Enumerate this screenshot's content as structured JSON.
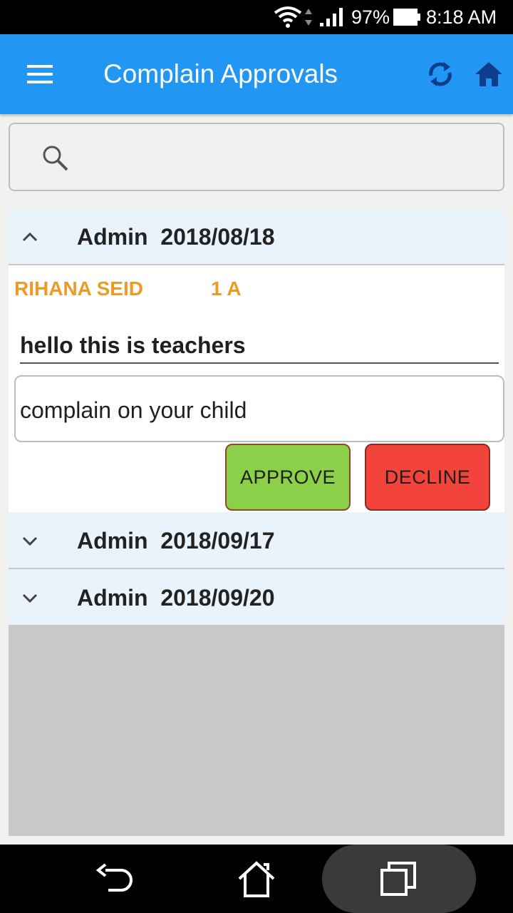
{
  "status_bar": {
    "battery_percent": "97%",
    "time": "8:18 AM",
    "icons": [
      "wifi-icon",
      "data-updown-icon",
      "signal-icon",
      "battery-icon"
    ]
  },
  "app_bar": {
    "title": "Complain Approvals",
    "icons": [
      "menu-icon",
      "sync-icon",
      "home-icon"
    ],
    "color": "#2196f3"
  },
  "search": {
    "value": "",
    "icon": "search-icon"
  },
  "groups": [
    {
      "title": "Admin  2018/08/18",
      "expanded": true,
      "item": {
        "student_name": "RIHANA SEID",
        "student_class": "1 A",
        "complain_title": "hello this is teachers",
        "complain_body": "complain on your child",
        "approve_label": "APPROVE",
        "decline_label": "DECLINE"
      }
    },
    {
      "title": "Admin  2018/09/17",
      "expanded": false
    },
    {
      "title": "Admin  2018/09/20",
      "expanded": false
    }
  ],
  "colors": {
    "accent": "#2196f3",
    "student_text": "#ef9a23",
    "approve": "#8ccf48",
    "decline": "#f2443a",
    "header_bg": "#e9f3fb"
  },
  "nav_bar": {
    "icons": [
      "back-icon",
      "home-nav-icon",
      "recent-apps-icon"
    ]
  }
}
